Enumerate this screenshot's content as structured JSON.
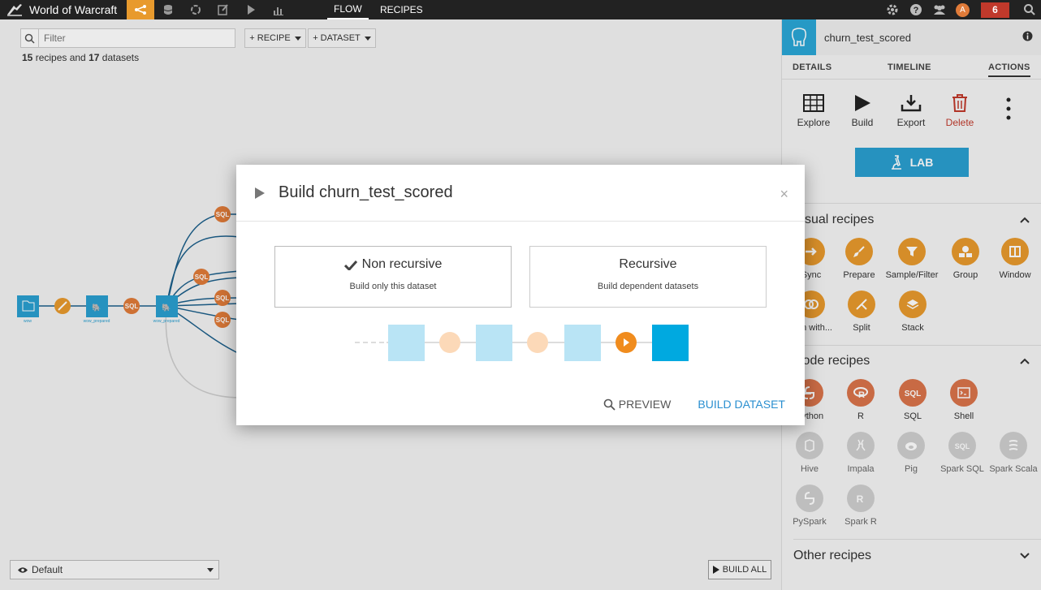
{
  "topbar": {
    "project_title": "World of Warcraft",
    "nav": [
      "FLOW",
      "RECIPES"
    ],
    "notifications": "6",
    "avatar_letter": "A",
    "accent": "#e89a2d"
  },
  "flow": {
    "filter_placeholder": "Filter",
    "add_recipe": "+ RECIPE",
    "add_dataset": "+ DATASET",
    "counts": {
      "recipes": "15",
      "recipes_text": " recipes and ",
      "datasets": "17",
      "datasets_text": " datasets"
    },
    "view": "Default",
    "build_all": "BUILD ALL",
    "recipe_badge": "SQL"
  },
  "panel": {
    "dataset_name": "churn_test_scored",
    "tabs": [
      "DETAILS",
      "TIMELINE",
      "ACTIONS"
    ],
    "actions": [
      "Explore",
      "Build",
      "Export",
      "Delete"
    ],
    "lab": "LAB",
    "visual_title": "Visual recipes",
    "visual_recipes": [
      "Sync",
      "Prepare",
      "Sample/Filter",
      "Group",
      "Window",
      "Join with...",
      "Split",
      "Stack"
    ],
    "code_title": "Code recipes",
    "code_recipes": [
      "Python",
      "R",
      "SQL",
      "Shell",
      "Hive",
      "Impala",
      "Pig",
      "Spark SQL",
      "Spark Scala",
      "PySpark",
      "Spark R"
    ],
    "other_title": "Other recipes"
  },
  "modal": {
    "title": "Build churn_test_scored",
    "close": "×",
    "options": [
      {
        "title": "Non recursive",
        "subtitle": "Build only this dataset"
      },
      {
        "title": "Recursive",
        "subtitle": "Build dependent datasets"
      }
    ],
    "preview": "PREVIEW",
    "build": "BUILD DATASET"
  }
}
